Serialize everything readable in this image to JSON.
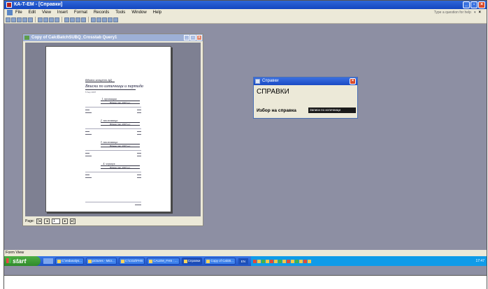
{
  "app": {
    "title": "КА-Т-ЕМ - [Справки]",
    "help_placeholder": "Type a question for help",
    "close_glyph": "×"
  },
  "menu": [
    "File",
    "Edit",
    "View",
    "Insert",
    "Format",
    "Records",
    "Tools",
    "Window",
    "Help"
  ],
  "child_window": {
    "title": "Copy of CalcBatchSUBQ_Crosstab Query1",
    "page_label": "Page:",
    "page_value": "1"
  },
  "report": {
    "top_text": "Вдовни концепт АД",
    "heading": "Вписки по изтичници и партида",
    "date": "5 Sep 2007",
    "sections": [
      {
        "title": "1. провинция",
        "sub": "Вдовни пак, 2007 н.г."
      },
      {
        "title": "2. заключваща",
        "sub": "Вдовни пак, 2007 н.г."
      },
      {
        "title": "3. заключваща",
        "sub": "Вдовни пак, 2007 н.г."
      },
      {
        "title": "4. черипук",
        "sub": "Вдовни пак, 2007 н.г."
      }
    ]
  },
  "dialog": {
    "title": "Справки",
    "heading": "СПРАВКИ",
    "label": "Избор на справка",
    "combo_value": "Записи по изтичници"
  },
  "statusbar": {
    "text": "Form View"
  },
  "taskbar": {
    "start_label": "start",
    "tasks": [
      "C:\\redanalys...",
      "pictures - Micr...",
      "C:\\COZ\\FHS",
      "CALEM_FHS : ...",
      "Справки",
      "Copy of CalcB..."
    ],
    "language": "EN",
    "clock": "17:47"
  }
}
